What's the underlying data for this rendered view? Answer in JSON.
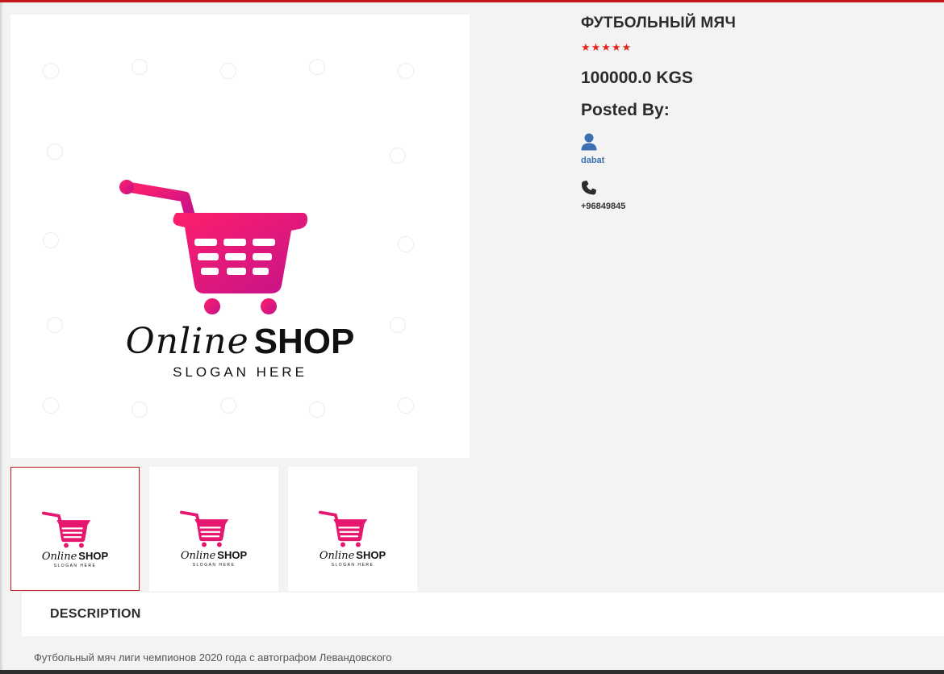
{
  "product": {
    "title": "ФУТБОЛЬНЫЙ МЯЧ",
    "rating": 5,
    "stars": "★★★★★",
    "price": "100000.0 KGS",
    "posted_by_label": "Posted By:",
    "seller_name": "dabat",
    "seller_phone": "+96849845"
  },
  "image": {
    "logo_online": "Online",
    "logo_shop": "SHOP",
    "logo_slogan": "SLOGAN HERE"
  },
  "thumbnails": [
    {
      "logo_online": "Online",
      "logo_shop": "SHOP",
      "logo_slogan": "SLOGAN HERE",
      "active": true
    },
    {
      "logo_online": "Online",
      "logo_shop": "SHOP",
      "logo_slogan": "SLOGAN HERE",
      "active": false
    },
    {
      "logo_online": "Online",
      "logo_shop": "SHOP",
      "logo_slogan": "SLOGAN HERE",
      "active": false
    }
  ],
  "description": {
    "tab_label": "DESCRIPTION",
    "text": "Футбольный мяч лиги чемпионов 2020 года с автографом Левандовского"
  },
  "icons": {
    "user": "user-icon",
    "phone": "phone-icon",
    "star": "star-icon",
    "cart": "shopping-cart-icon"
  },
  "colors": {
    "accent_red": "#c4161c",
    "star_red": "#e3261c",
    "link_blue": "#3b6fb0",
    "cart_gradient_start": "#ff1f6b",
    "cart_gradient_end": "#c4128a"
  }
}
